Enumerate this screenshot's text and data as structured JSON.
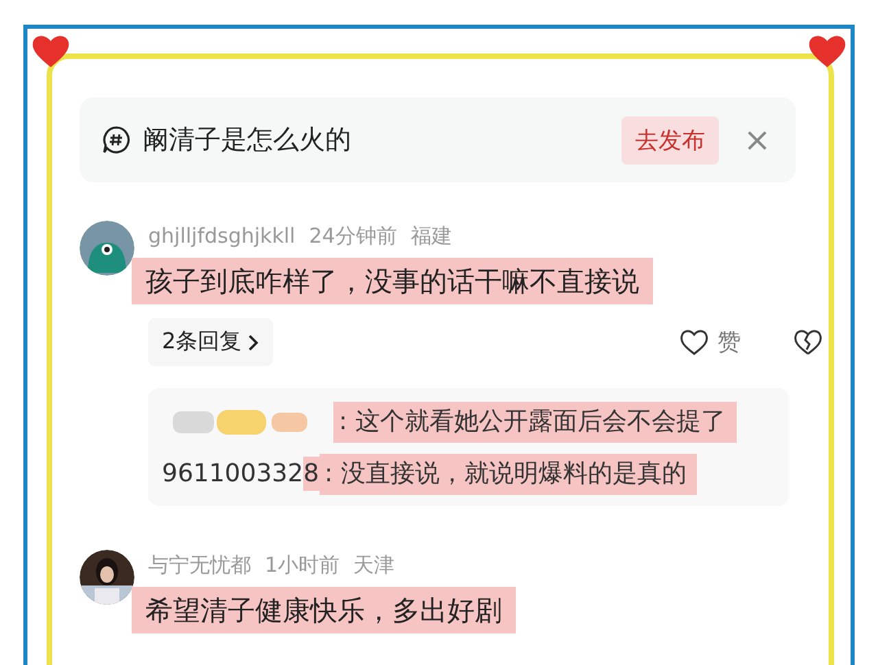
{
  "topic": {
    "title": "阚清子是怎么火的",
    "action": "去发布",
    "close": "×"
  },
  "comments": [
    {
      "user": "ghjlljfdsghjkkll",
      "time": "24分钟前",
      "place": "福建",
      "text": "孩子到底咋样了，没事的话干嘛不直接说",
      "avatar": {
        "kind": "monster"
      },
      "replies_label": "2条回复",
      "like": "赞",
      "replies": [
        {
          "text": ": 这个就看她公开露面后会不会提了"
        },
        {
          "user": "961100332",
          "user_highlighted": "8",
          "text": ": 没直接说，就说明爆料的是真的"
        }
      ]
    },
    {
      "user": "与宁无忧都",
      "time": "1小时前",
      "place": "天津",
      "text": "希望清子健康快乐，多出好剧"
    }
  ]
}
